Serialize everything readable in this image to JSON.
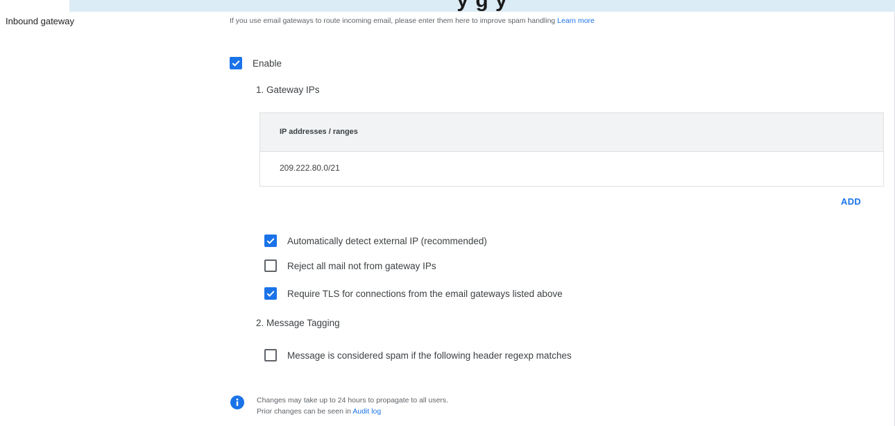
{
  "banner": {
    "title": "y          g     y"
  },
  "section": {
    "label": "Inbound gateway",
    "description": "If you use email gateways to route incoming email, please enter them here to improve spam handling",
    "learn_more": "Learn more"
  },
  "enable": {
    "label": "Enable",
    "checked": true
  },
  "gateway_ips": {
    "heading": "1. Gateway IPs",
    "table": {
      "header": "IP addresses / ranges",
      "rows": [
        "209.222.80.0/21"
      ]
    },
    "add_label": "ADD"
  },
  "options": [
    {
      "label": "Automatically detect external IP (recommended)",
      "checked": true
    },
    {
      "label": "Reject all mail not from gateway IPs",
      "checked": false
    },
    {
      "label": "Require TLS for connections from the email gateways listed above",
      "checked": true
    }
  ],
  "message_tagging": {
    "heading": "2. Message Tagging",
    "option": {
      "label": "Message is considered spam if the following header regexp matches",
      "checked": false
    }
  },
  "notice": {
    "icon": "info-icon",
    "line1": "Changes may take up to 24 hours to propagate to all users.",
    "line2_prefix": "Prior changes can be seen in",
    "audit_log": "Audit log"
  },
  "colors": {
    "accent": "#1a73e8",
    "banner_bg": "#dcecf6",
    "table_header_bg": "#f1f3f4"
  }
}
